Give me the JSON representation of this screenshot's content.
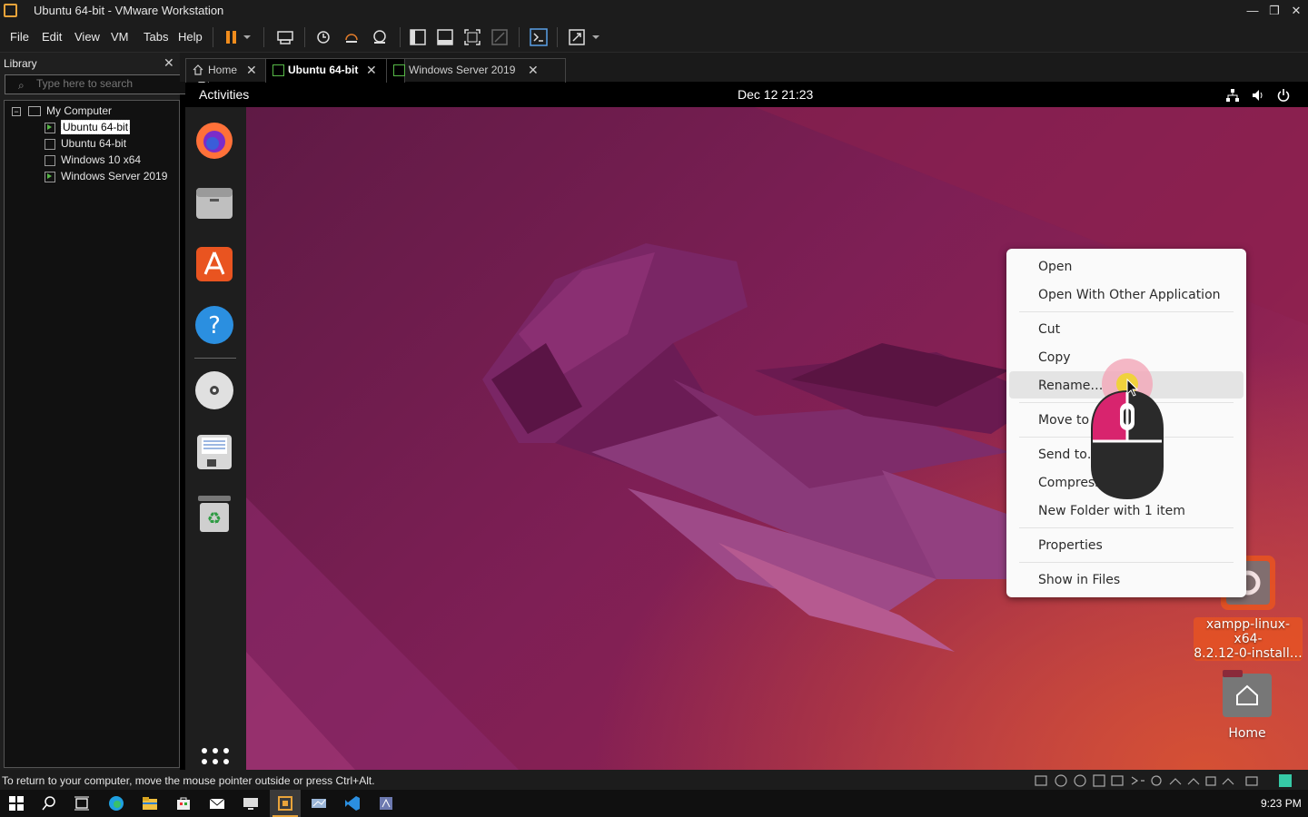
{
  "window": {
    "title": "Ubuntu 64-bit - VMware Workstation"
  },
  "menu": [
    "File",
    "Edit",
    "View",
    "VM",
    "Tabs",
    "Help"
  ],
  "library": {
    "title": "Library",
    "search_placeholder": "Type here to search",
    "root": "My Computer",
    "vms": [
      "Ubuntu 64-bit",
      "Ubuntu 64-bit",
      "Windows 10 x64",
      "Windows Server 2019"
    ]
  },
  "tabs": [
    "Home",
    "Ubuntu 64-bit",
    "Windows Server 2019"
  ],
  "guest": {
    "activities": "Activities",
    "clock": "Dec 12  21:23",
    "context_menu": {
      "items": [
        "Open",
        "Open With Other Application",
        "Cut",
        "Copy",
        "Rename…",
        "Move to Trash",
        "Send to…",
        "Compress…",
        "New Folder with 1 item",
        "Properties",
        "Show in Files"
      ]
    },
    "desktop": {
      "file_label_1": "xampp-linux-x64-",
      "file_label_2": "8.2.12-0-install…",
      "home_label": "Home"
    }
  },
  "status": {
    "text": "To return to your computer, move the mouse pointer outside or press Ctrl+Alt."
  },
  "taskbar": {
    "time": "9:23 PM"
  },
  "colors": {
    "accent": "#e95420",
    "highlight": "#e4e4e4"
  }
}
